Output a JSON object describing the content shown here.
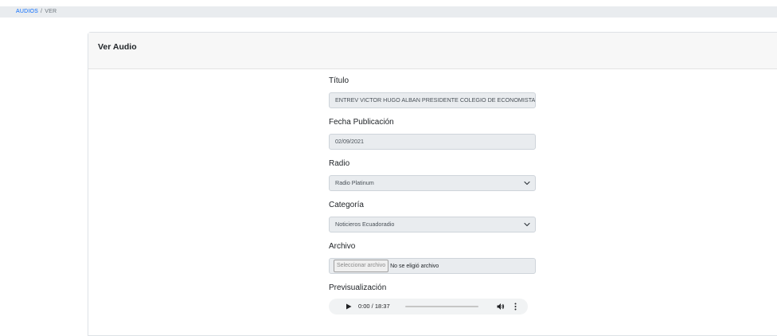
{
  "breadcrumb": {
    "items": [
      "AUDIOS",
      "VER"
    ],
    "separator": "/"
  },
  "card": {
    "title": "Ver Audio"
  },
  "fields": {
    "titulo": {
      "label": "Título",
      "value": "ENTREV VICTOR HUGO ALBAN PRESIDENTE COLEGIO DE ECONOMISTAS DEL GUAYAS"
    },
    "fecha": {
      "label": "Fecha Publicación",
      "value": "02/09/2021"
    },
    "radio": {
      "label": "Radio",
      "value": "Radio Platinum"
    },
    "categoria": {
      "label": "Categoría",
      "value": "Noticieros Ecuadoradio"
    },
    "archivo": {
      "label": "Archivo",
      "button": "Seleccionar archivo",
      "status": "No se eligió archivo"
    },
    "preview": {
      "label": "Previsualización",
      "time": "0:00 / 18:37",
      "progress": 0
    }
  },
  "colors": {
    "link": "#0d6efd",
    "disabled_bg": "#e9ecef",
    "header_bg": "#f7f7f7"
  },
  "icons": [
    "play-icon",
    "volume-icon",
    "more-options-icon",
    "chevron-down-icon"
  ]
}
